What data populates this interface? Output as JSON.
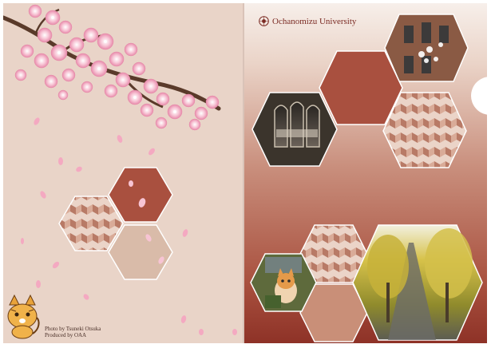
{
  "university": {
    "name": "Ochanomizu University"
  },
  "credits": {
    "photo": "Photo by Tsuneki Otsuka",
    "produced": "Produced by OAA"
  },
  "colors": {
    "left_bg": "#e9d4c8",
    "hex_dark": "#a9503f",
    "hex_light": "#d9bba9",
    "pattern_base": "#ebd4c8",
    "pattern_dark": "#b87a66"
  },
  "icons": [
    "sakura-branch",
    "cat-mascot",
    "university-emblem"
  ]
}
